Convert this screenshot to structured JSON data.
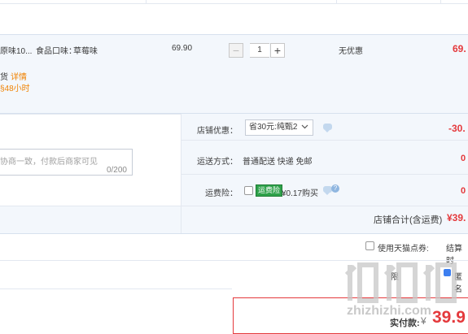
{
  "item": {
    "name_partial": "原味10...",
    "flavor_label": "食品口味：",
    "flavor_value": "草莓味",
    "price": "69.90",
    "quantity": "1",
    "minus": "−",
    "plus": "+",
    "promo": "无优惠",
    "subtotal_partial": "69.",
    "delivery_partial": "货",
    "details_link": "详情",
    "ship_time_partial": "§48小时"
  },
  "message": {
    "placeholder_partial": "协商一致，付款后商家可见",
    "counter": "0/200"
  },
  "shop_discount": {
    "label": "店铺优惠：",
    "selected": "省30元:纯甄2",
    "amount_partial": "-30."
  },
  "shipping": {
    "label": "运送方式：",
    "value": "普通配送 快递 免邮",
    "amount_partial": "0"
  },
  "freight_insurance": {
    "label": "运费险：",
    "badge": "运费险",
    "price": "¥0.17购买",
    "amount_partial": "0"
  },
  "shop_total": {
    "label": "店铺合计(含运费)",
    "amount_partial": "¥39."
  },
  "coupon": {
    "label": "使用天猫点券:",
    "settle_partial": "结算时"
  },
  "footer": {
    "left_partial": "限",
    "right_partial": "匿名",
    "paid_label": "实付款:",
    "currency": "¥",
    "paid_amount_partial": "39.9"
  },
  "watermark": "zhizhizhi.com",
  "colors": {
    "panel_bg": "#f3f7fc",
    "border": "#e3e8f0",
    "price_red": "#e4393c",
    "link_orange": "#f08200",
    "order_box_border": "#e4393c",
    "insurance_green": "#2ea14a"
  }
}
